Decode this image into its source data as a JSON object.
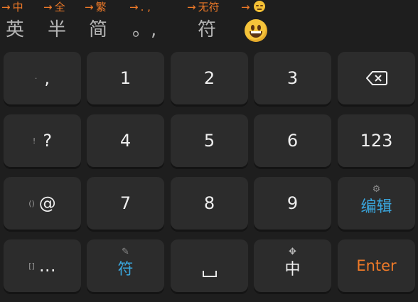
{
  "hints": [
    {
      "arrow": "→",
      "label": "中"
    },
    {
      "arrow": "→",
      "label": "全"
    },
    {
      "arrow": "→",
      "label": "繁"
    },
    {
      "arrow": "→",
      "label": ". ,"
    },
    {
      "arrow": "→",
      "label": "无符"
    },
    {
      "arrow": "→",
      "label": ""
    }
  ],
  "candidates": {
    "ying": "英",
    "ban": "半",
    "jian": "简",
    "punct": "。,",
    "fu": "符"
  },
  "keys": {
    "r1": {
      "sym_small": "·",
      "sym_main": ",",
      "k1": "1",
      "k2": "2",
      "k3": "3"
    },
    "r2": {
      "sym_small": "!",
      "sym_main": "?",
      "k1": "4",
      "k2": "5",
      "k3": "6",
      "num": "123"
    },
    "r3": {
      "sym_small": "()",
      "sym_main": "@",
      "k1": "7",
      "k2": "8",
      "k3": "9",
      "edit": "编辑"
    },
    "r4": {
      "sym_small": "[]",
      "sym_main": "…",
      "fu": "符",
      "zhong": "中",
      "enter": "Enter"
    }
  },
  "colors": {
    "accent_orange": "#f07a28",
    "accent_blue": "#3aa6dd",
    "key_bg": "#2c2c2c",
    "bg": "#1e1e1e"
  },
  "icons": {
    "delete": "backspace-icon",
    "settings": "gear-icon",
    "pencil": "pencil-icon",
    "move": "move-arrows-icon",
    "hint_emoji": "sleepy-face-icon",
    "candidate_emoji": "grinning-face-icon"
  }
}
